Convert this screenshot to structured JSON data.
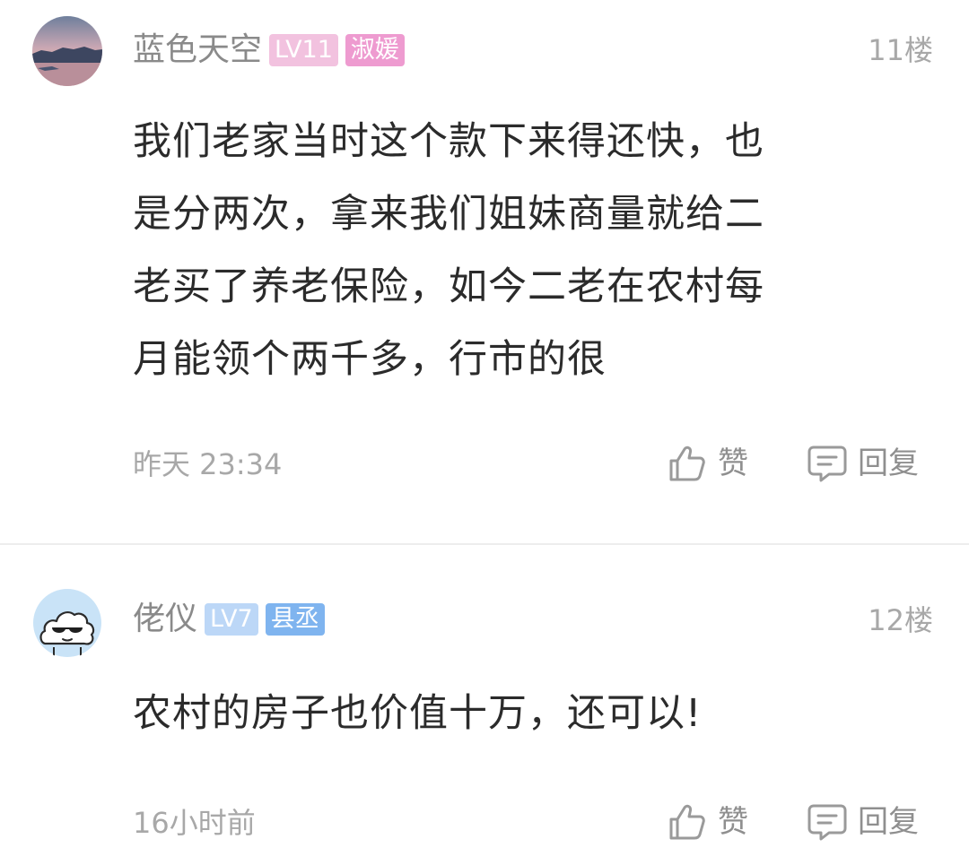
{
  "comments": [
    {
      "username": "蓝色天空",
      "level_badge": "LV11",
      "title_badge": "淑媛",
      "floor": "11楼",
      "content_lines": [
        "我们老家当时这个款下来得还快，也",
        "是分两次，拿来我们姐妹商量就给二",
        "老买了养老保险，如今二老在农村每",
        "月能领个两千多，行市的很"
      ],
      "time": "昨天 23:34",
      "like_label": "赞",
      "reply_label": "回复",
      "avatar_icon": "sunset-landscape-avatar",
      "badge_colors": {
        "level": "#f2c2df",
        "title": "#ee9bd0"
      }
    },
    {
      "username": "佬仪",
      "level_badge": "LV7",
      "title_badge": "县丞",
      "floor": "12楼",
      "content_lines": [
        "农村的房子也价值十万，还可以!"
      ],
      "time": "16小时前",
      "like_label": "赞",
      "reply_label": "回复",
      "avatar_icon": "cloud-sunglasses-avatar",
      "badge_colors": {
        "level": "#bcd7f7",
        "title": "#7fb4ef"
      }
    }
  ]
}
